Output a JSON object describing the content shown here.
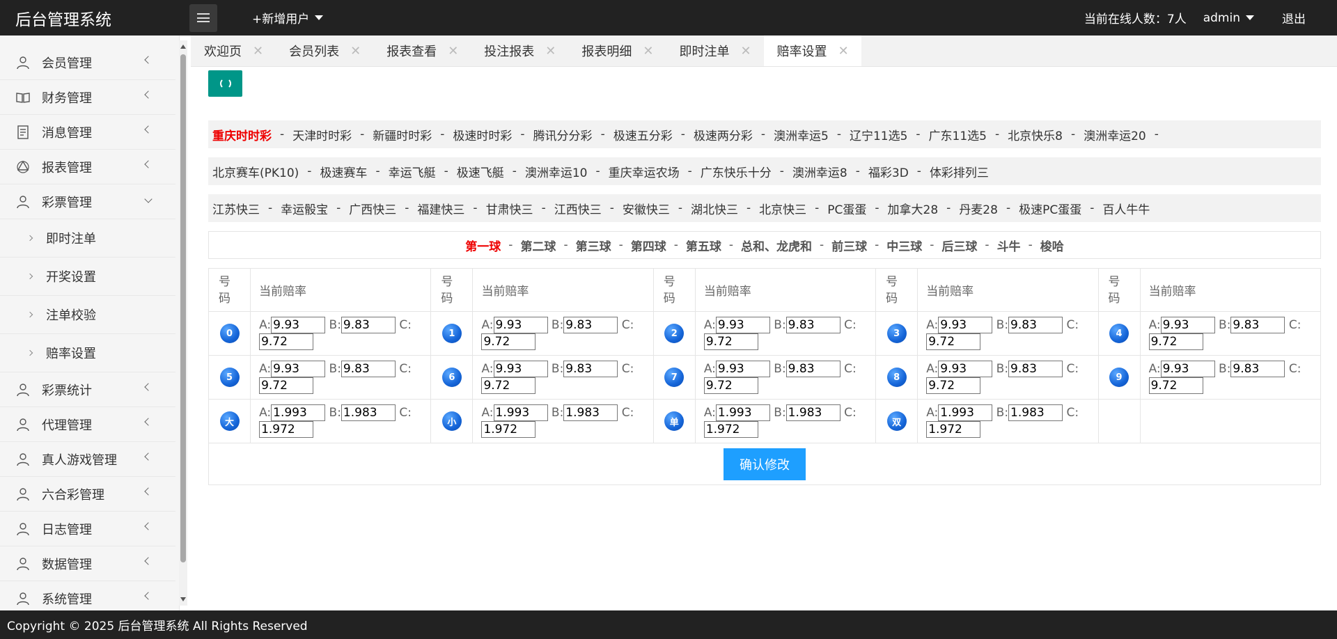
{
  "header": {
    "title": "后台管理系统",
    "add_user_label": "+新增用户",
    "online_text": "当前在线人数：7人",
    "admin_label": "admin",
    "logout_label": "退出"
  },
  "sidebar": {
    "items": [
      {
        "label": "会员管理",
        "icon": "user-icon"
      },
      {
        "label": "财务管理",
        "icon": "book-icon"
      },
      {
        "label": "消息管理",
        "icon": "document-icon"
      },
      {
        "label": "报表管理",
        "icon": "recycle-icon"
      },
      {
        "label": "彩票管理",
        "icon": "user-icon"
      },
      {
        "label": "彩票统计",
        "icon": "users-icon"
      },
      {
        "label": "代理管理",
        "icon": "users-icon"
      },
      {
        "label": "真人游戏管理",
        "icon": "users-icon"
      },
      {
        "label": "六合彩管理",
        "icon": "users-icon"
      },
      {
        "label": "日志管理",
        "icon": "users-icon"
      },
      {
        "label": "数据管理",
        "icon": "users-icon"
      },
      {
        "label": "系统管理",
        "icon": "users-icon"
      }
    ],
    "sub_items": [
      "即时注单",
      "开奖设置",
      "注单校验",
      "赔率设置"
    ]
  },
  "tabs": [
    "欢迎页",
    "会员列表",
    "报表查看",
    "投注报表",
    "报表明细",
    "即时注单",
    "赔率设置"
  ],
  "tab_close": "✕",
  "lottery_rows": [
    [
      "重庆时时彩",
      "天津时时彩",
      "新疆时时彩",
      "极速时时彩",
      "腾讯分分彩",
      "极速五分彩",
      "极速两分彩",
      "澳洲幸运5",
      "辽宁11选5",
      "广东11选5",
      "北京快乐8",
      "澳洲幸运20"
    ],
    [
      "北京赛车(PK10)",
      "极速赛车",
      "幸运飞艇",
      "极速飞艇",
      "澳洲幸运10",
      "重庆幸运农场",
      "广东快乐十分",
      "澳洲幸运8",
      "福彩3D",
      "体彩排列三"
    ],
    [
      "江苏快三",
      "幸运骰宝",
      "广西快三",
      "福建快三",
      "甘肃快三",
      "江西快三",
      "安徽快三",
      "湖北快三",
      "北京快三",
      "PC蛋蛋",
      "加拿大28",
      "丹麦28",
      "极速PC蛋蛋",
      "百人牛牛"
    ]
  ],
  "balls": [
    "第一球",
    "第二球",
    "第三球",
    "第四球",
    "第五球",
    "总和、龙虎和",
    "前三球",
    "中三球",
    "后三球",
    "斗牛",
    "梭哈"
  ],
  "separator": "-",
  "table": {
    "col_num": "号码",
    "col_rate": "当前赔率",
    "label_a": "A:",
    "label_b": "B:",
    "label_c": "C:",
    "rows": [
      [
        {
          "badge": "0",
          "a": "9.93",
          "b": "9.83",
          "c": "9.72"
        },
        {
          "badge": "1",
          "a": "9.93",
          "b": "9.83",
          "c": "9.72"
        },
        {
          "badge": "2",
          "a": "9.93",
          "b": "9.83",
          "c": "9.72"
        },
        {
          "badge": "3",
          "a": "9.93",
          "b": "9.83",
          "c": "9.72"
        },
        {
          "badge": "4",
          "a": "9.93",
          "b": "9.83",
          "c": "9.72"
        }
      ],
      [
        {
          "badge": "5",
          "a": "9.93",
          "b": "9.83",
          "c": "9.72"
        },
        {
          "badge": "6",
          "a": "9.93",
          "b": "9.83",
          "c": "9.72"
        },
        {
          "badge": "7",
          "a": "9.93",
          "b": "9.83",
          "c": "9.72"
        },
        {
          "badge": "8",
          "a": "9.93",
          "b": "9.83",
          "c": "9.72"
        },
        {
          "badge": "9",
          "a": "9.93",
          "b": "9.83",
          "c": "9.72"
        }
      ],
      [
        {
          "badge": "大",
          "a": "1.993",
          "b": "1.983",
          "c": "1.972"
        },
        {
          "badge": "小",
          "a": "1.993",
          "b": "1.983",
          "c": "1.972"
        },
        {
          "badge": "单",
          "a": "1.993",
          "b": "1.983",
          "c": "1.972"
        },
        {
          "badge": "双",
          "a": "1.993",
          "b": "1.983",
          "c": "1.972"
        }
      ]
    ],
    "confirm_label": "确认修改"
  },
  "footer": {
    "copyright": "Copyright © 2025 后台管理系统 All Rights Reserved"
  },
  "colors": {
    "header_bg": "#222222",
    "accent_green": "#009688",
    "accent_blue": "#1e9fff",
    "active_red": "#e00000"
  }
}
